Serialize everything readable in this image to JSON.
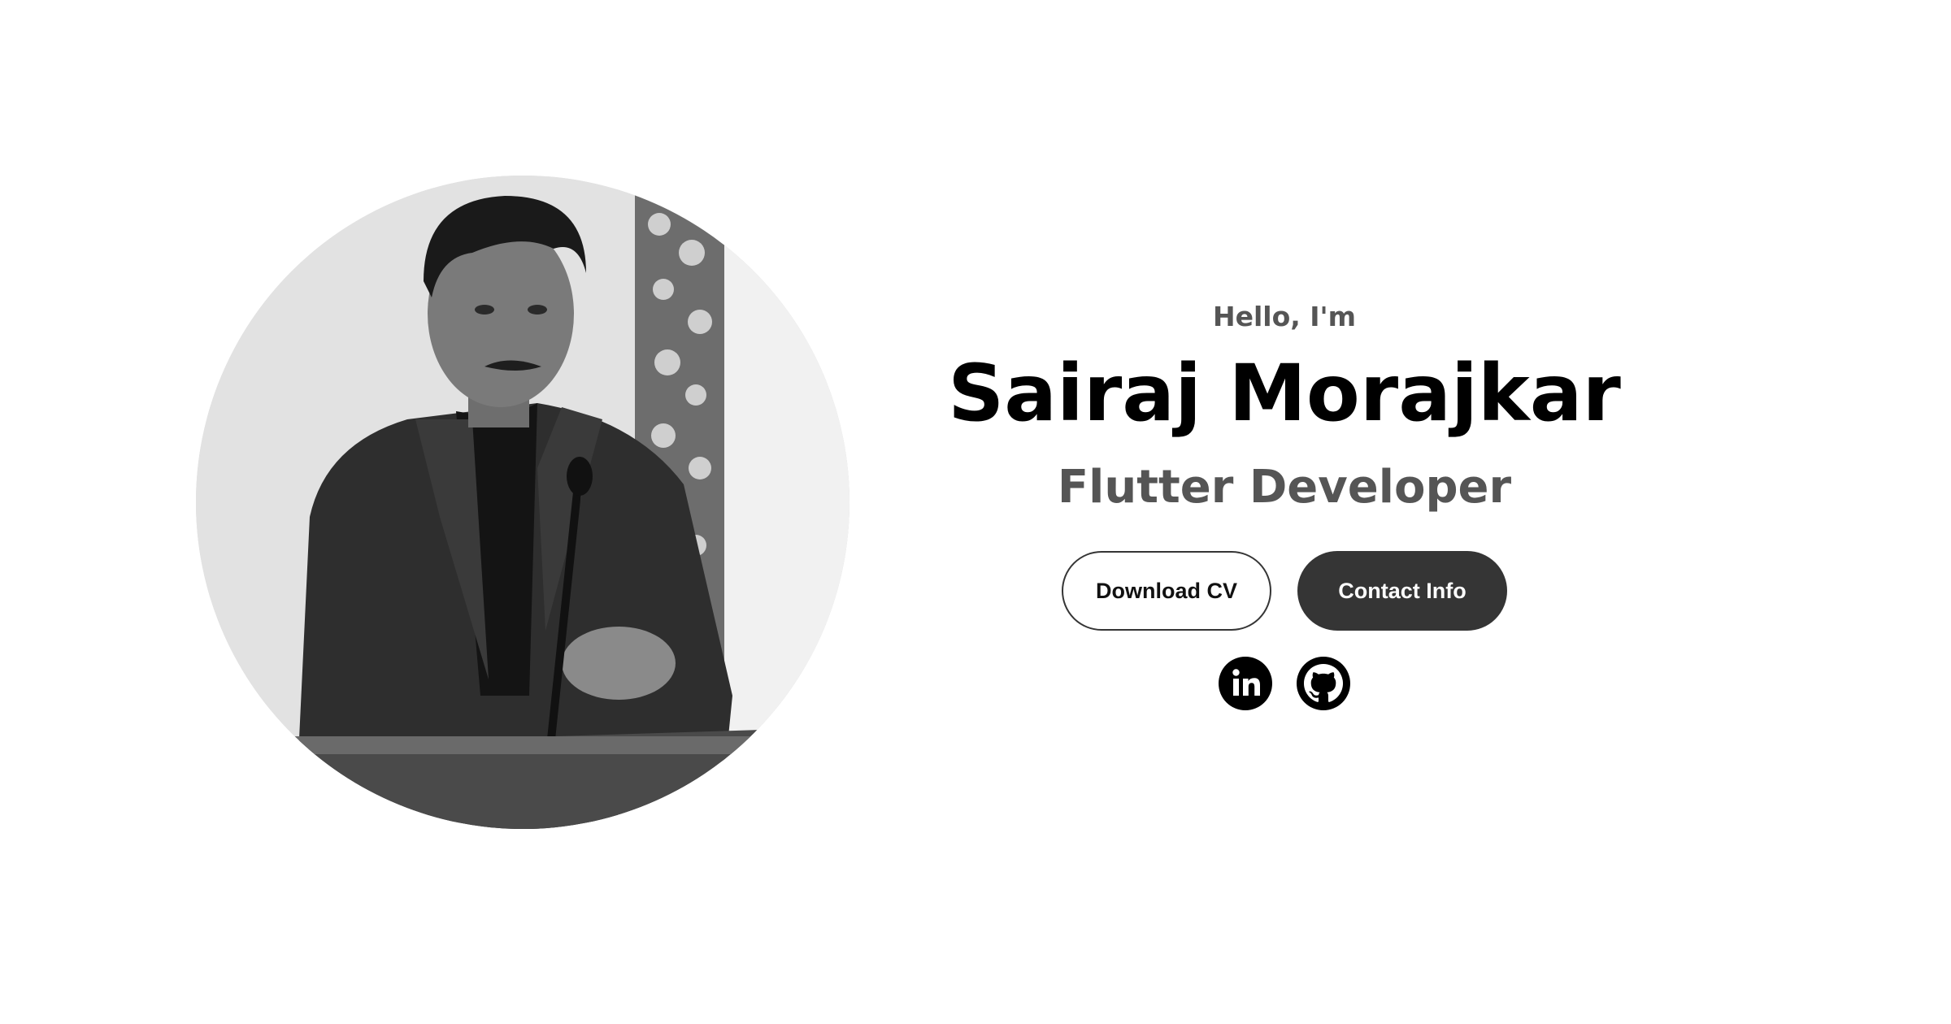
{
  "hero": {
    "greeting": "Hello, I'm",
    "name": "Sairaj Morajkar",
    "role": "Flutter Developer",
    "photo_alt": "Profile picture"
  },
  "buttons": {
    "download_cv": "Download CV",
    "contact_info": "Contact Info"
  },
  "socials": [
    {
      "icon": "linkedin-icon",
      "label": "LinkedIn"
    },
    {
      "icon": "github-icon",
      "label": "GitHub"
    }
  ],
  "colors": {
    "text_primary": "#000000",
    "text_secondary": "#555555",
    "button_dark": "#353535",
    "background": "#ffffff"
  }
}
